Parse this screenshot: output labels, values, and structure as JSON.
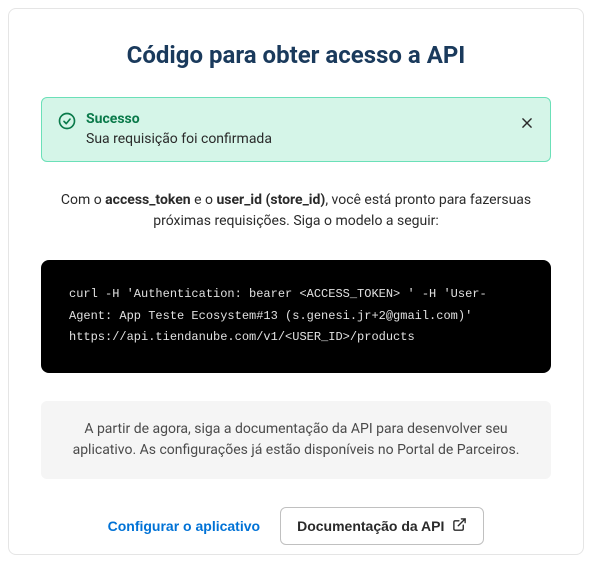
{
  "title": "Código para obter acesso a API",
  "alert": {
    "title": "Sucesso",
    "message": "Sua requisição foi confirmada"
  },
  "description": {
    "prefix": "Com o ",
    "token1": "access_token",
    "middle1": " e o ",
    "token2": "user_id (store_id)",
    "suffix": ", você está pronto para fazersuas próximas requisições. Siga o modelo a seguir:"
  },
  "code": "curl -H 'Authentication: bearer <ACCESS_TOKEN> ' -H 'User-Agent: App Teste Ecosystem#13 (s.genesi.jr+2@gmail.com)' https://api.tiendanube.com/v1/<USER_ID>/products",
  "info": "A partir de agora, siga a documentação da API para desenvolver seu aplicativo. As configurações já estão disponíveis no Portal de Parceiros.",
  "actions": {
    "configure": "Configurar o aplicativo",
    "docs": "Documentação da API"
  }
}
